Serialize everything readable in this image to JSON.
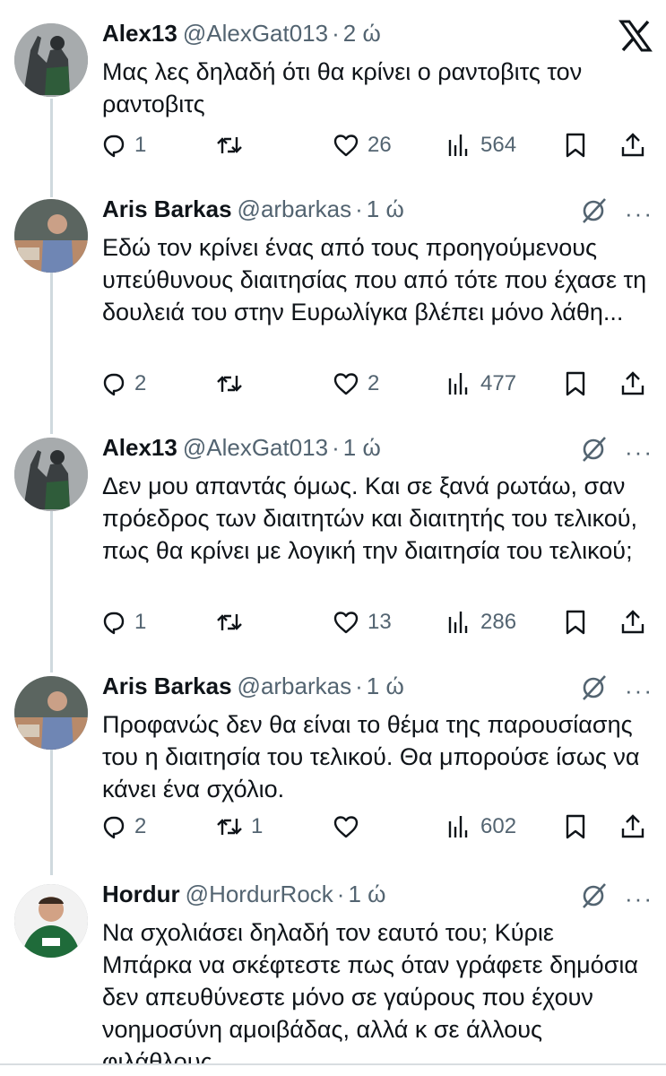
{
  "tweets": [
    {
      "name": "Alex13",
      "handle": "@AlexGat013",
      "time": "2 ώ",
      "text": "Μας λες δηλαδή ότι θα κρίνει ο ραντοβιτς τον ραντοβιτς",
      "replies": "1",
      "retweets": "",
      "likes": "26",
      "views": "564"
    },
    {
      "name": "Aris Barkas",
      "handle": "@arbarkas",
      "time": "1 ώ",
      "text": "Εδώ τον κρίνει ένας από τους προηγούμενους υπεύθυνους διαιτησίας που από τότε που έχασε τη δουλειά του στην Ευρωλίγκα βλέπει μόνο λάθη...",
      "replies": "2",
      "retweets": "",
      "likes": "2",
      "views": "477"
    },
    {
      "name": "Alex13",
      "handle": "@AlexGat013",
      "time": "1 ώ",
      "text": "Δεν μου απαντάς όμως. Και σε ξανά ρωτάω, σαν πρόεδρος των διαιτητών και διαιτητής του τελικού, πως θα κρίνει με λογική την διαιτησία του τελικού;",
      "replies": "1",
      "retweets": "",
      "likes": "13",
      "views": "286"
    },
    {
      "name": "Aris Barkas",
      "handle": "@arbarkas",
      "time": "1 ώ",
      "text": "Προφανώς δεν θα είναι το θέμα της παρουσίασης του η διαιτησία του τελικού. Θα μπορούσε ίσως να κάνει ένα σχόλιο.",
      "replies": "2",
      "retweets": "1",
      "likes": "",
      "views": "602"
    },
    {
      "name": "Hordur",
      "handle": "@HordurRock",
      "time": "1 ώ",
      "text": "Να σχολιάσει δηλαδή τον εαυτό του; Κύριε Μπάρκα να σκέφτεστε πως όταν γράφετε δημόσια δεν απευθύνεστε μόνο σε γαύρους που έχουν νοημοσύνη αμοιβάδας, αλλά κ σε άλλους φιλάθλους."
    }
  ],
  "colors": {
    "text": "#0f1419",
    "muted": "#536471",
    "line": "#cfd9de"
  },
  "icons": [
    "x-logo-icon",
    "grok-icon",
    "more-icon",
    "reply-icon",
    "retweet-icon",
    "like-icon",
    "views-icon",
    "bookmark-icon",
    "share-icon"
  ]
}
